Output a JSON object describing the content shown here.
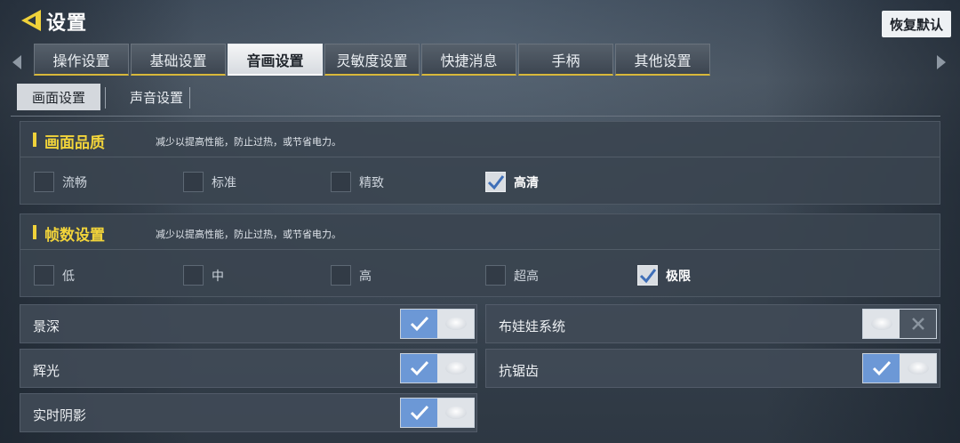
{
  "header": {
    "title": "设置",
    "reset_label": "恢复默认"
  },
  "tabs": [
    {
      "label": "操作设置",
      "active": false
    },
    {
      "label": "基础设置",
      "active": false
    },
    {
      "label": "音画设置",
      "active": true
    },
    {
      "label": "灵敏度设置",
      "active": false
    },
    {
      "label": "快捷消息",
      "active": false
    },
    {
      "label": "手柄",
      "active": false
    },
    {
      "label": "其他设置",
      "active": false
    }
  ],
  "subtabs": [
    {
      "label": "画面设置",
      "active": true
    },
    {
      "label": "声音设置",
      "active": false
    }
  ],
  "quality": {
    "title": "画面品质",
    "desc": "减少以提高性能，防止过热，或节省电力。",
    "options": [
      {
        "label": "流畅",
        "checked": false
      },
      {
        "label": "标准",
        "checked": false
      },
      {
        "label": "精致",
        "checked": false
      },
      {
        "label": "高清",
        "checked": true
      }
    ]
  },
  "framerate": {
    "title": "帧数设置",
    "desc": "减少以提高性能，防止过热，或节省电力。",
    "options": [
      {
        "label": "低",
        "checked": false
      },
      {
        "label": "中",
        "checked": false
      },
      {
        "label": "高",
        "checked": false
      },
      {
        "label": "超高",
        "checked": false
      },
      {
        "label": "极限",
        "checked": true
      }
    ]
  },
  "toggles": [
    {
      "label": "景深",
      "on": true
    },
    {
      "label": "布娃娃系统",
      "on": false
    },
    {
      "label": "辉光",
      "on": true
    },
    {
      "label": "抗锯齿",
      "on": true
    },
    {
      "label": "实时阴影",
      "on": true
    }
  ],
  "colors": {
    "accent_yellow": "#f2d43a",
    "toggle_on_blue": "#6c98d6"
  },
  "icons": {
    "back": "back-triangle-icon",
    "left": "chevron-left-icon",
    "right": "chevron-right-icon",
    "check": "checkmark-icon",
    "close": "close-icon"
  }
}
